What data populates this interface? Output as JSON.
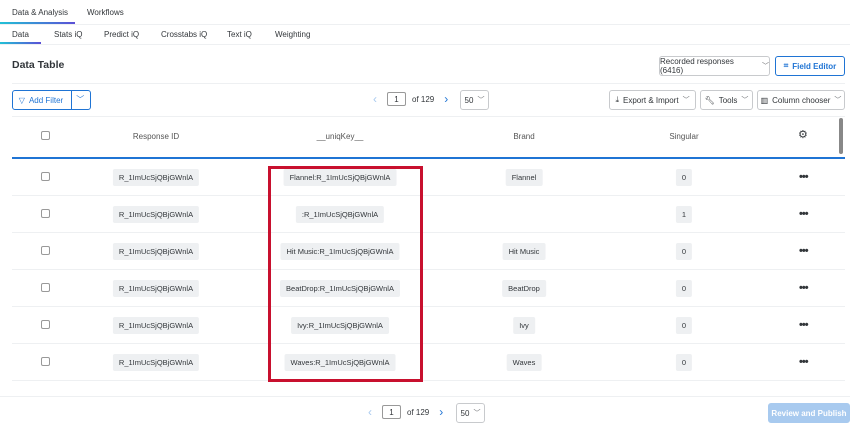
{
  "top_tabs": [
    "Data & Analysis",
    "Workflows"
  ],
  "sub_tabs": [
    "Data",
    "Stats iQ",
    "Predict iQ",
    "Crosstabs iQ",
    "Text iQ",
    "Weighting"
  ],
  "page_title": "Data Table",
  "recorded_responses": "Recorded responses (6416)",
  "field_editor": "Field Editor",
  "add_filter": "Add Filter",
  "pager": {
    "page": "1",
    "of": "of 129",
    "per_page": "50"
  },
  "toolbar": {
    "export": "Export & Import",
    "tools": "Tools",
    "columns": "Column chooser"
  },
  "columns": [
    "Response ID",
    "__uniqKey__",
    "Brand",
    "Singular"
  ],
  "rows": [
    {
      "id": "R_1ImUcSjQBjGWnlA",
      "key": "Flannel:R_1ImUcSjQBjGWnlA",
      "brand": "Flannel",
      "singular": "0"
    },
    {
      "id": "R_1ImUcSjQBjGWnlA",
      "key": ":R_1ImUcSjQBjGWnlA",
      "brand": "",
      "singular": "1"
    },
    {
      "id": "R_1ImUcSjQBjGWnlA",
      "key": "Hit Music:R_1ImUcSjQBjGWnlA",
      "brand": "Hit Music",
      "singular": "0"
    },
    {
      "id": "R_1ImUcSjQBjGWnlA",
      "key": "BeatDrop:R_1ImUcSjQBjGWnlA",
      "brand": "BeatDrop",
      "singular": "0"
    },
    {
      "id": "R_1ImUcSjQBjGWnlA",
      "key": "Ivy:R_1ImUcSjQBjGWnlA",
      "brand": "Ivy",
      "singular": "0"
    },
    {
      "id": "R_1ImUcSjQBjGWnlA",
      "key": "Waves:R_1ImUcSjQBjGWnlA",
      "brand": "Waves",
      "singular": "0"
    }
  ],
  "review_publish": "Review and Publish",
  "colors": {
    "accent": "#1f74d4",
    "highlight": "#c8102e",
    "disabled": "#a8caef"
  }
}
